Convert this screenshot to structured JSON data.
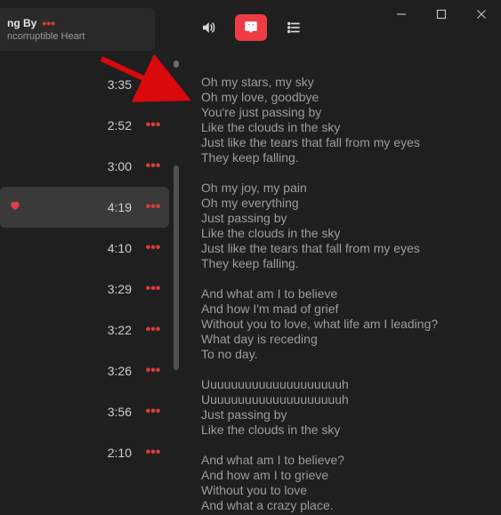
{
  "window": {
    "min": "−",
    "max": "□",
    "close": "✕"
  },
  "nowPlaying": {
    "title": "ng By",
    "subtitle": "ncorruptible Heart",
    "more": "•••"
  },
  "toolbar": {
    "speaker": "speaker-icon",
    "lyrics": "lyrics-icon",
    "queue": "queue-icon"
  },
  "tracks": [
    {
      "time": "3:35",
      "fav": false
    },
    {
      "time": "2:52",
      "fav": false
    },
    {
      "time": "3:00",
      "fav": false
    },
    {
      "time": "4:19",
      "fav": true,
      "selected": true
    },
    {
      "time": "4:10",
      "fav": false
    },
    {
      "time": "3:29",
      "fav": false
    },
    {
      "time": "3:22",
      "fav": false
    },
    {
      "time": "3:26",
      "fav": false
    },
    {
      "time": "3:56",
      "fav": false
    },
    {
      "time": "2:10",
      "fav": false
    }
  ],
  "more_glyph": "•••",
  "lyrics": {
    "s1": "Oh my stars, my sky\nOh my love, goodbye\nYou're just passing by\nLike the clouds in the sky\nJust like the tears that fall from my eyes\nThey keep falling.",
    "s2": "Oh my joy, my pain\nOh my everything\nJust passing by\nLike the clouds in the sky\nJust like the tears that fall from my eyes\nThey keep falling.",
    "s3": "And what am I to believe\nAnd how I'm mad of grief\nWithout you to love, what life am I leading?\nWhat day is receding\nTo no day.",
    "s4": "Uuuuuuuuuuuuuuuuuuuuh\nUuuuuuuuuuuuuuuuuuuuh\nJust passing by\nLike the clouds in the sky",
    "s5": "And what am I to believe?\nAnd how am I to grieve\nWithout you to love\nAnd what a crazy place."
  }
}
